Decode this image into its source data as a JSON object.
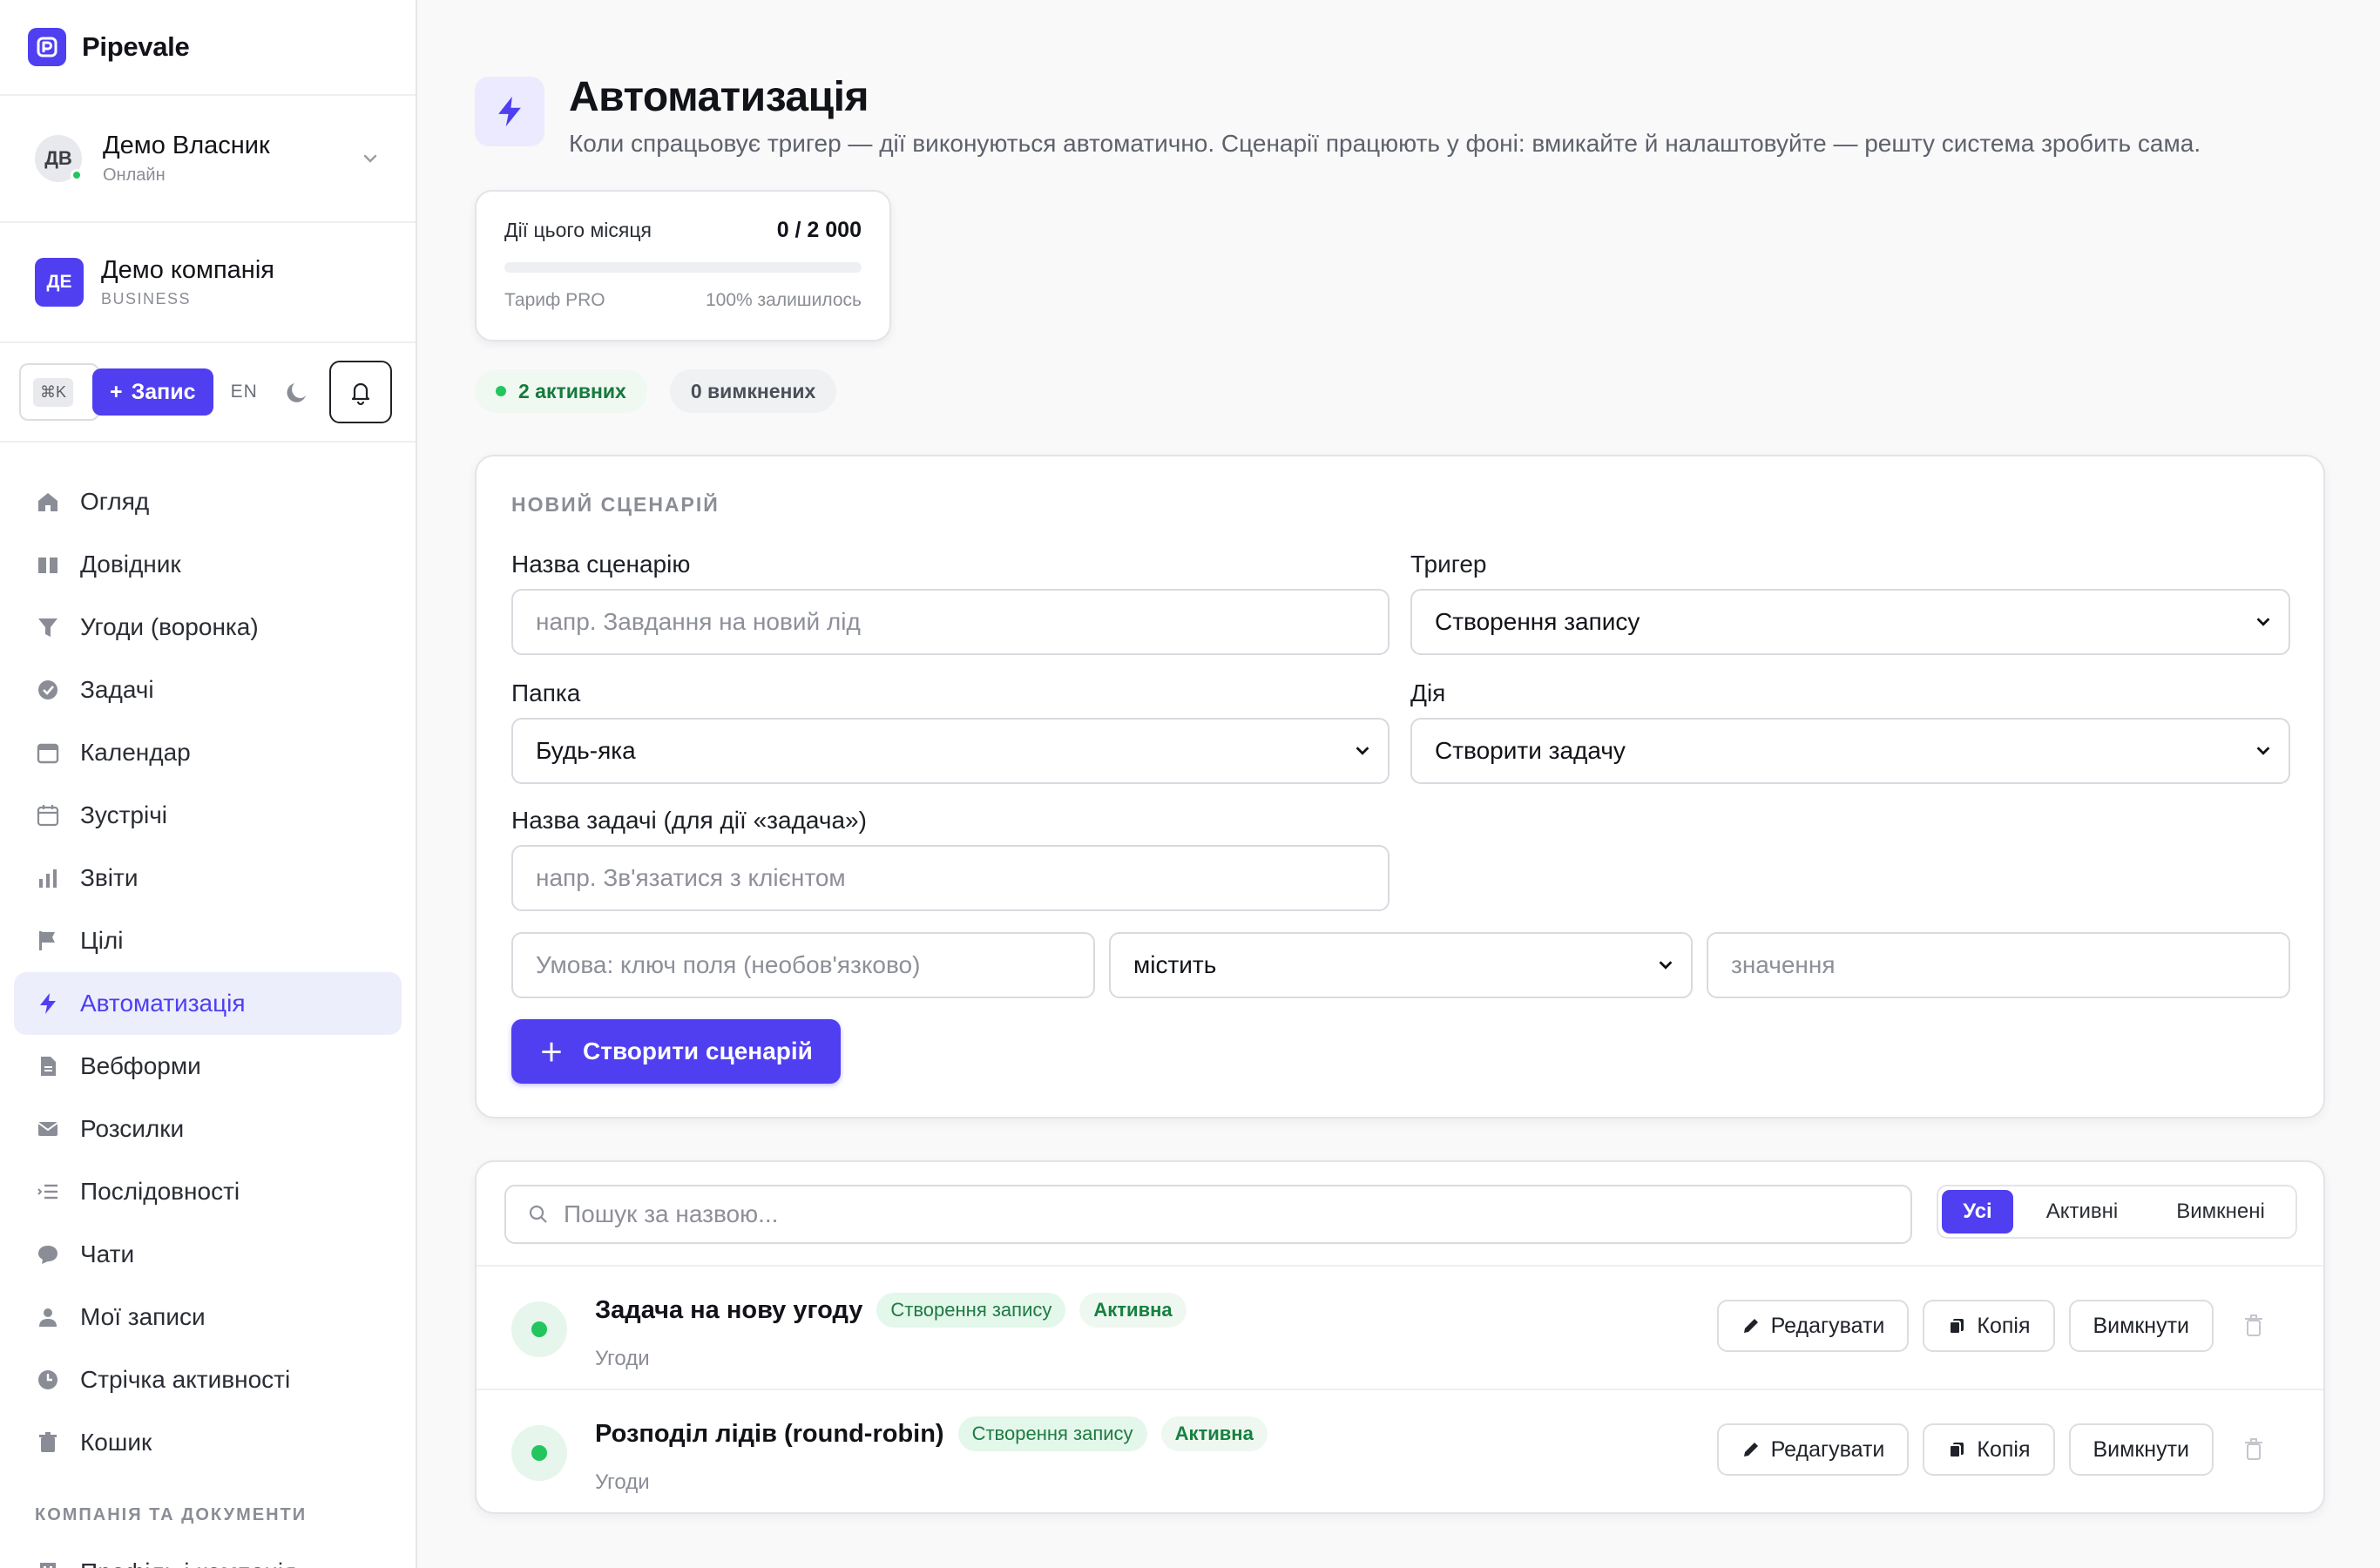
{
  "brand": {
    "name": "Pipevale"
  },
  "user": {
    "initials": "ДВ",
    "name": "Демо Власник",
    "status": "Онлайн"
  },
  "company": {
    "initials": "ДЕ",
    "name": "Демо компанія",
    "plan": "BUSINESS"
  },
  "toolbar": {
    "shortcut": "⌘K",
    "add_label": "Запис",
    "lang": "EN"
  },
  "nav": {
    "items": [
      {
        "label": "Огляд",
        "icon": "home-icon"
      },
      {
        "label": "Довідник",
        "icon": "book-icon"
      },
      {
        "label": "Угоди (воронка)",
        "icon": "funnel-icon"
      },
      {
        "label": "Задачі",
        "icon": "check-circle-icon"
      },
      {
        "label": "Календар",
        "icon": "calendar-icon"
      },
      {
        "label": "Зустрічі",
        "icon": "calendar-outline-icon"
      },
      {
        "label": "Звіти",
        "icon": "bar-chart-icon"
      },
      {
        "label": "Цілі",
        "icon": "flag-icon"
      },
      {
        "label": "Автоматизація",
        "icon": "bolt-icon",
        "active": true
      },
      {
        "label": "Вебформи",
        "icon": "document-icon"
      },
      {
        "label": "Розсилки",
        "icon": "mail-icon"
      },
      {
        "label": "Послідовності",
        "icon": "list-icon"
      },
      {
        "label": "Чати",
        "icon": "chat-icon"
      },
      {
        "label": "Мої записи",
        "icon": "user-icon"
      },
      {
        "label": "Стрічка активності",
        "icon": "clock-icon"
      },
      {
        "label": "Кошик",
        "icon": "trash-icon"
      }
    ],
    "section_title": "КОМПАНІЯ ТА ДОКУМЕНТИ",
    "section_items": [
      {
        "label": "Профіль і компанія",
        "icon": "building-icon"
      }
    ]
  },
  "page": {
    "title": "Автоматизація",
    "subtitle": "Коли спрацьовує тригер — дії виконуються автоматично. Сценарії працюють у фоні: вмикайте й налаштовуйте — решту система зробить сама."
  },
  "usage": {
    "label": "Дії цього місяця",
    "value": "0 / 2 000",
    "used_fraction": 0,
    "plan": "Тариф PRO",
    "remaining": "100% залишилось"
  },
  "pills": {
    "active": "2 активних",
    "off": "0 вимкнених"
  },
  "form": {
    "section_title": "НОВИЙ СЦЕНАРІЙ",
    "name_label": "Назва сценарію",
    "name_placeholder": "напр. Завдання на новий лід",
    "trigger_label": "Тригер",
    "trigger_value": "Створення запису",
    "folder_label": "Папка",
    "folder_value": "Будь-яка",
    "action_label": "Дія",
    "action_value": "Створити задачу",
    "task_label": "Назва задачі (для дії «задача»)",
    "task_placeholder": "напр. Зв'язатися з клієнтом",
    "cond_key_placeholder": "Умова: ключ поля (необов'язково)",
    "cond_op_value": "містить",
    "cond_value_placeholder": "значення",
    "create_label": "Створити сценарій"
  },
  "list": {
    "search_placeholder": "Пошук за назвою...",
    "filters": [
      "Усі",
      "Активні",
      "Вимкнені"
    ],
    "rows": [
      {
        "title": "Задача на нову угоду",
        "trigger": "Створення запису",
        "state": "Активна",
        "folder": "Угоди"
      },
      {
        "title": "Розподіл лідів (round-robin)",
        "trigger": "Створення запису",
        "state": "Активна",
        "folder": "Угоди"
      }
    ],
    "actions": {
      "edit": "Редагувати",
      "copy": "Копія",
      "disable": "Вимкнути"
    }
  },
  "colors": {
    "accent": "#4f3ff0",
    "success": "#22c55e",
    "muted": "#8a8d95"
  }
}
